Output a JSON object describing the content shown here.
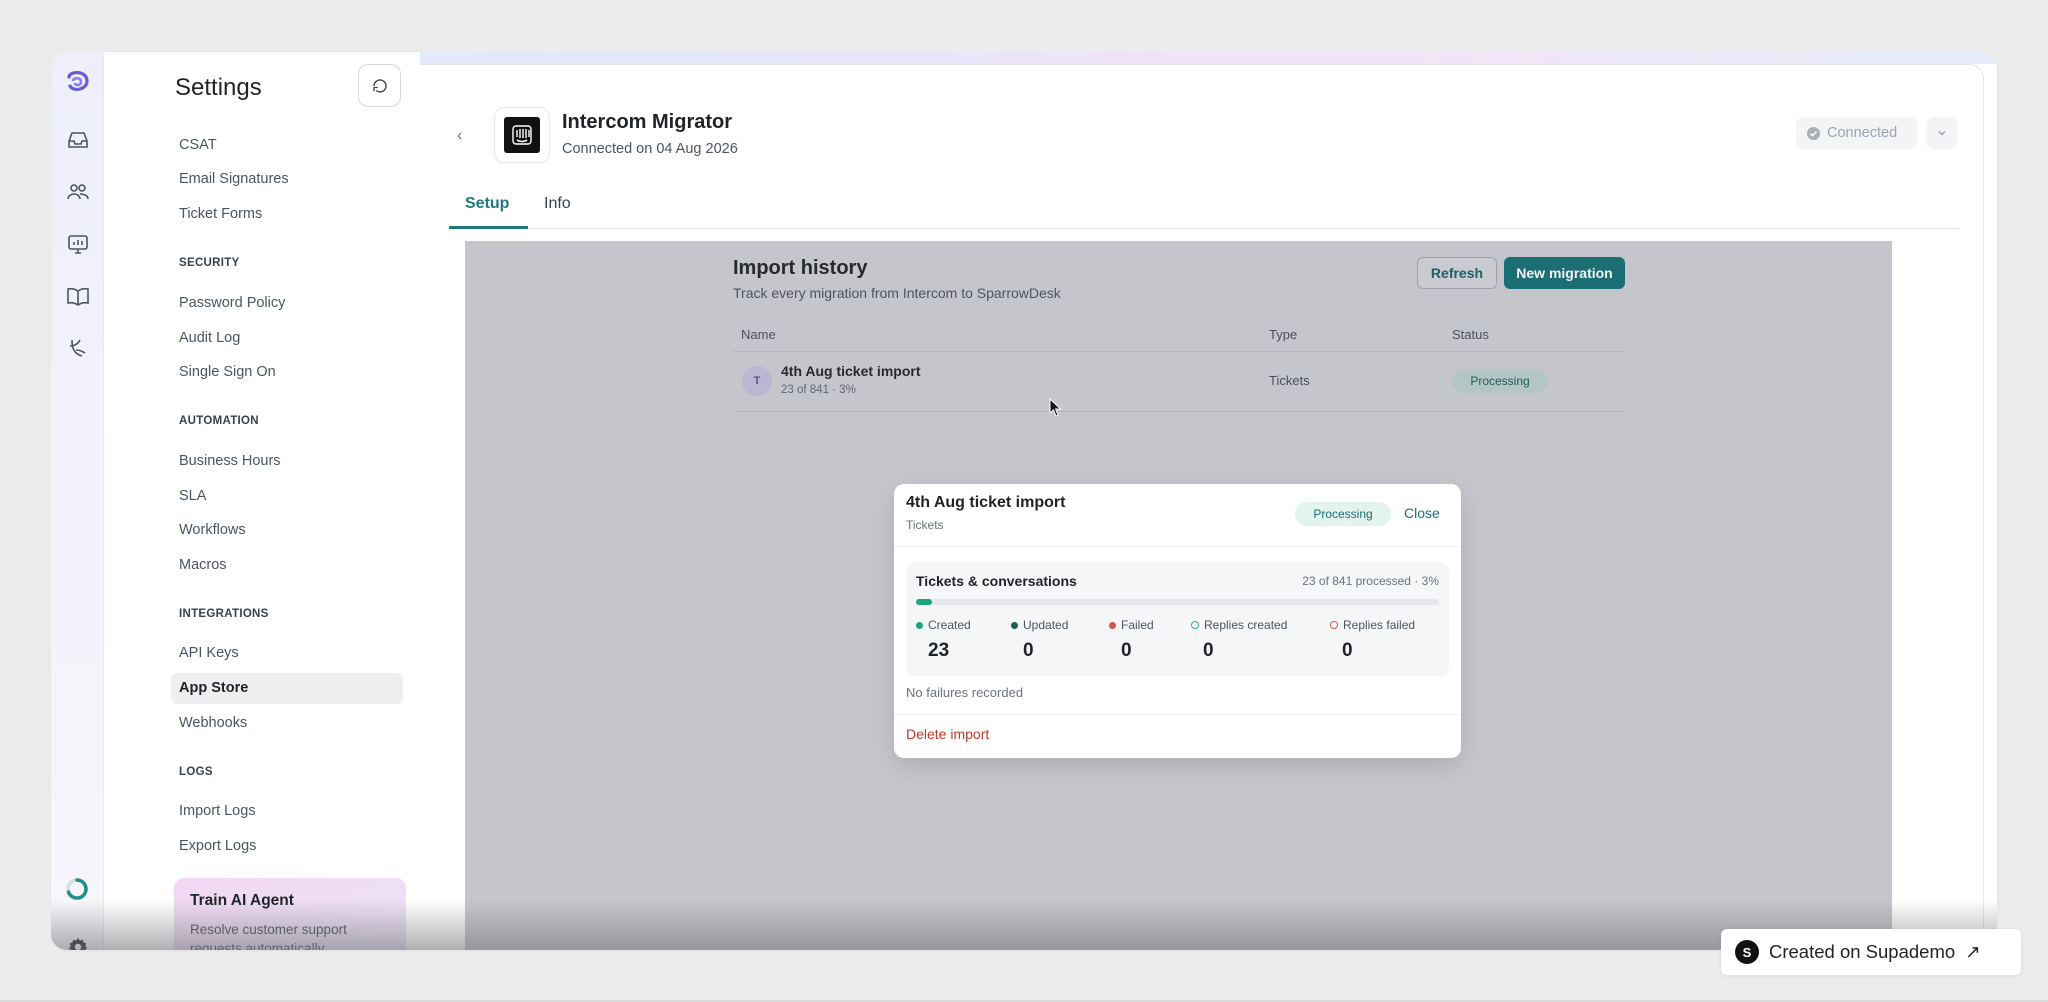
{
  "rail": {
    "icons": [
      "logo-icon",
      "inbox-icon",
      "contacts-icon",
      "reports-icon",
      "knowledge-base-icon",
      "ai-agent-icon",
      "loading-icon",
      "settings-icon"
    ]
  },
  "settings": {
    "title": "Settings",
    "nav": {
      "csat": "CSAT",
      "email_signatures": "Email Signatures",
      "ticket_forms": "Ticket Forms",
      "security_header": "SECURITY",
      "password_policy": "Password Policy",
      "audit_log": "Audit Log",
      "single_sign_on": "Single Sign On",
      "automation_header": "AUTOMATION",
      "business_hours": "Business Hours",
      "sla": "SLA",
      "workflows": "Workflows",
      "macros": "Macros",
      "integrations_header": "INTEGRATIONS",
      "api_keys": "API Keys",
      "app_store": "App Store",
      "webhooks": "Webhooks",
      "logs_header": "LOGS",
      "import_logs": "Import Logs",
      "export_logs": "Export Logs"
    },
    "train_card": {
      "title": "Train AI Agent",
      "desc": "Resolve customer support requests automatically"
    }
  },
  "app": {
    "name": "Intercom Migrator",
    "connected_on": "Connected on 04 Aug 2026",
    "status": "Connected",
    "tabs": {
      "setup": "Setup",
      "info": "Info"
    }
  },
  "import_history": {
    "title": "Import history",
    "subtitle": "Track every migration from Intercom to SparrowDesk",
    "refresh_label": "Refresh",
    "new_migration_label": "New migration",
    "columns": {
      "name": "Name",
      "type": "Type",
      "status": "Status"
    },
    "rows": [
      {
        "avatar": "T",
        "name": "4th Aug ticket import",
        "progress": "23 of 841 · 3%",
        "type": "Tickets",
        "status": "Processing"
      }
    ]
  },
  "modal": {
    "title": "4th Aug ticket import",
    "subtitle": "Tickets",
    "status": "Processing",
    "close_label": "Close",
    "card": {
      "title": "Tickets & conversations",
      "processed": "23 of 841 processed · 3%",
      "progress_percent": 3
    },
    "stats": {
      "created": {
        "label": "Created",
        "value": "23"
      },
      "updated": {
        "label": "Updated",
        "value": "0"
      },
      "failed": {
        "label": "Failed",
        "value": "0"
      },
      "replies_created": {
        "label": "Replies created",
        "value": "0"
      },
      "replies_failed": {
        "label": "Replies failed",
        "value": "0"
      }
    },
    "no_failures": "No failures recorded",
    "delete_label": "Delete import"
  },
  "colors": {
    "accent": "#1f7a7f",
    "created": "#1aa67a",
    "updated": "#1b5e57",
    "failed": "#d9534f",
    "replies_created": "#2bb089",
    "replies_failed": "#d9534f"
  },
  "supademo": {
    "logo": "S",
    "label": "Created on Supademo",
    "arrow": "↗"
  }
}
